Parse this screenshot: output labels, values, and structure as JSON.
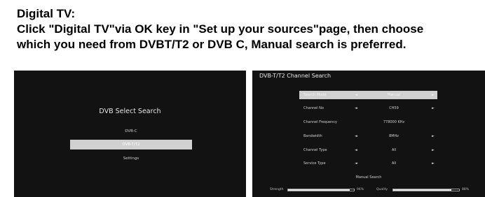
{
  "document": {
    "heading": "Digital TV:",
    "instruction_line1": "Click \"Digital TV\"via OK key in \"Set up your sources\"page, then choose",
    "instruction_line2": "which you need from DVBT/T2 or DVB C, Manual search is preferred."
  },
  "dvb_select": {
    "title": "DVB Select Search",
    "options": [
      {
        "label": "DVB-C",
        "selected": false
      },
      {
        "label": "DVB-T/T2",
        "selected": true
      },
      {
        "label": "Settings",
        "selected": false
      }
    ]
  },
  "channel_search": {
    "title": "DVB-T/T2 Channel Search",
    "rows": [
      {
        "label": "Search Mode",
        "value": "Manual",
        "left_arrow": "◄",
        "right_arrow": "►",
        "selected": true
      },
      {
        "label": "Channel No",
        "value": "CH59",
        "left_arrow": "◄",
        "right_arrow": "►",
        "selected": false
      },
      {
        "label": "Channel Frequency",
        "value": "778000 KHz",
        "left_arrow": "",
        "right_arrow": "",
        "selected": false
      },
      {
        "label": "Bandwidth",
        "value": "8MHz",
        "left_arrow": "◄",
        "right_arrow": "►",
        "selected": false
      },
      {
        "label": "Channel Type",
        "value": "All",
        "left_arrow": "◄",
        "right_arrow": "►",
        "selected": false
      },
      {
        "label": "Service Type",
        "value": "All",
        "left_arrow": "◄",
        "right_arrow": "►",
        "selected": false
      }
    ],
    "manual_search_label": "Manual Search",
    "strength": {
      "label": "Strength",
      "value": "94%",
      "level": 0.94
    },
    "quality": {
      "label": "Quality",
      "value": "88%",
      "level": 0.88
    }
  },
  "colors": {
    "panel_bg": "#121212",
    "highlight": "#d0d0d0"
  }
}
